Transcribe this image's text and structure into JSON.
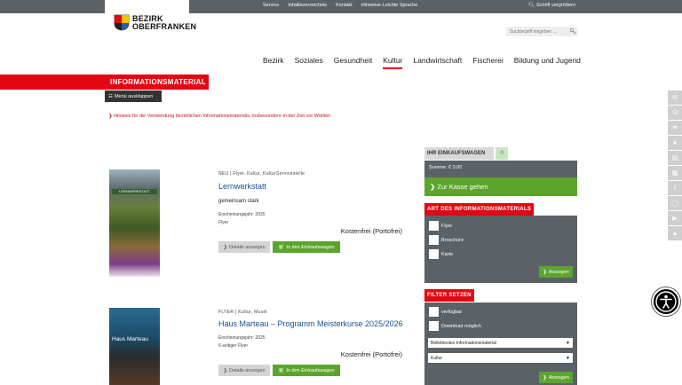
{
  "topbar": {
    "links": [
      "Service",
      "Inhaltsverzeichnis",
      "Kontakt",
      "Hinweise Leichte Sprache"
    ],
    "zoom_label": "Schrift vergrößern"
  },
  "logo": {
    "line1": "BEZIRK",
    "line2": "OBERFRANKEN"
  },
  "search": {
    "placeholder": "Suchbegriff eingeben ..."
  },
  "nav": [
    "Bezirk",
    "Soziales",
    "Gesundheit",
    "Kultur",
    "Landwirtschaft",
    "Fischerei",
    "Bildung und Jugend"
  ],
  "nav_active": "Kultur",
  "page_title": "INFORMATIONSMATERIAL",
  "menu_button": "Menü ausklappen",
  "hint": "Hinweis für die Verwendung bezirklichen Informationsmaterials, insbesondere in der Zeit vor Wahlen",
  "products": [
    {
      "meta": "NEU | Flyer, Kultur, KulturServicestelle",
      "title": "Lernwerkstatt",
      "subtitle": "gemeinsam stark",
      "year": "Erscheinungsjahr: 2025",
      "type": "Flyer",
      "price": "Kostenfrei (Portofrei)",
      "image_caption": "LERNWERKSTATT",
      "details_label": "Details anzeigen",
      "cart_label": "In den Einkaufswagen"
    },
    {
      "meta": "FLYER | Kultur, Musik",
      "title": "Haus Marteau – Programm Meisterkurse 2025/2026",
      "year": "Erscheinungsjahr: 2025",
      "type": "6-seitiger Flyer",
      "price": "Kostenfrei (Portofrei)",
      "image_caption": "Haus Marteau",
      "details_label": "Details anzeigen",
      "cart_label": "In den Einkaufswagen"
    }
  ],
  "cart": {
    "title": "IHR EINKAUFSWAGEN",
    "count": "0",
    "sum": "Summe: € 0,00",
    "checkout": "Zur Kasse gehen"
  },
  "type_filter": {
    "title": "ART DES INFORMATIONSMATERIALS",
    "options": [
      "Flyer",
      "Broschüre",
      "Karte"
    ],
    "button": "Anzeigen"
  },
  "set_filter": {
    "title": "FILTER SETZEN",
    "options": [
      "verfügbar",
      "Download möglich"
    ],
    "sort_value": "Beliebtestes Informationsmaterial",
    "category_value": "Kultur",
    "button": "Anzeigen"
  },
  "social_icons": [
    "mail-icon",
    "print-icon",
    "rss-icon",
    "user-icon",
    "book-icon",
    "newsletter-icon",
    "facebook-icon",
    "instagram-icon",
    "youtube-icon",
    "scroll-up-icon"
  ],
  "colors": {
    "red": "#e30613",
    "green": "#5ca52c",
    "gray": "#5a6268",
    "link_blue": "#1a4f92"
  }
}
